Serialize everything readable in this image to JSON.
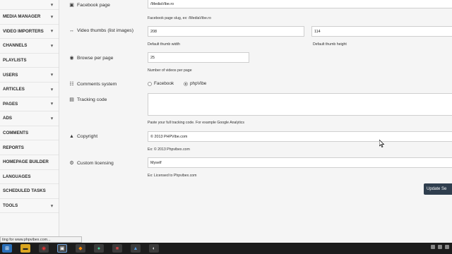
{
  "sidebar": {
    "items": [
      {
        "label": "MEDIA MANAGER",
        "has_chevron": true
      },
      {
        "label": "VIDEO IMPORTERS",
        "has_chevron": true
      },
      {
        "label": "CHANNELS",
        "has_chevron": true
      },
      {
        "label": "PLAYLISTS",
        "has_chevron": false
      },
      {
        "label": "USERS",
        "has_chevron": true
      },
      {
        "label": "ARTICLES",
        "has_chevron": true
      },
      {
        "label": "PAGES",
        "has_chevron": true
      },
      {
        "label": "ADS",
        "has_chevron": true
      },
      {
        "label": "COMMENTS",
        "has_chevron": false
      },
      {
        "label": "REPORTS",
        "has_chevron": false
      },
      {
        "label": "HOMEPAGE BUILDER",
        "has_chevron": false
      },
      {
        "label": "LANGUAGES",
        "has_chevron": false
      },
      {
        "label": "SCHEDULED TASKS",
        "has_chevron": false
      },
      {
        "label": "TOOLS",
        "has_chevron": true
      }
    ],
    "chevron_glyph": "▾"
  },
  "form": {
    "facebook_page": {
      "label": "Facebook page",
      "value": "/MediaVibe.ro",
      "hint": "Facebook page slug, ex: /MediaVibe.ro"
    },
    "video_thumbs": {
      "label": "Video thumbs (list images)",
      "width_value": "208",
      "width_hint": "Default thumb width",
      "height_value": "114",
      "height_hint": "Default thumb height"
    },
    "browse_per_page": {
      "label": "Browse per page",
      "value": "25",
      "hint": "Number of videos per page"
    },
    "comments_system": {
      "label": "Comments system",
      "options": [
        "Facebook",
        "phpVibe"
      ],
      "selected": "phpVibe"
    },
    "tracking_code": {
      "label": "Tracking code",
      "value": "",
      "hint": "Paste your full tracking code. For example Google Analytics"
    },
    "copyright": {
      "label": "Copyright",
      "value": "© 2013 PHPVibe.com",
      "hint": "Ex: © 2013 Phpvibex.com"
    },
    "custom_licensing": {
      "label": "Custom licensing",
      "value": "Myself",
      "hint": "Ex: Licensed to Phpvibex.com"
    },
    "update_button": "Update Se"
  },
  "status_bar": {
    "url": "ting for www.phpvibex.com..."
  },
  "colors": {
    "accent_button": "#2f3e4e",
    "taskbar": "#1c1c1c",
    "start_button": "#2a6fb8"
  },
  "icons": {
    "facebook": "facebook-icon",
    "thumbs": "resize-arrows-icon",
    "browse": "circle-dot-icon",
    "comments": "chat-bubbles-icon",
    "tracking": "chart-box-icon",
    "copyright": "triangle-icon",
    "licensing": "gear-icon"
  }
}
